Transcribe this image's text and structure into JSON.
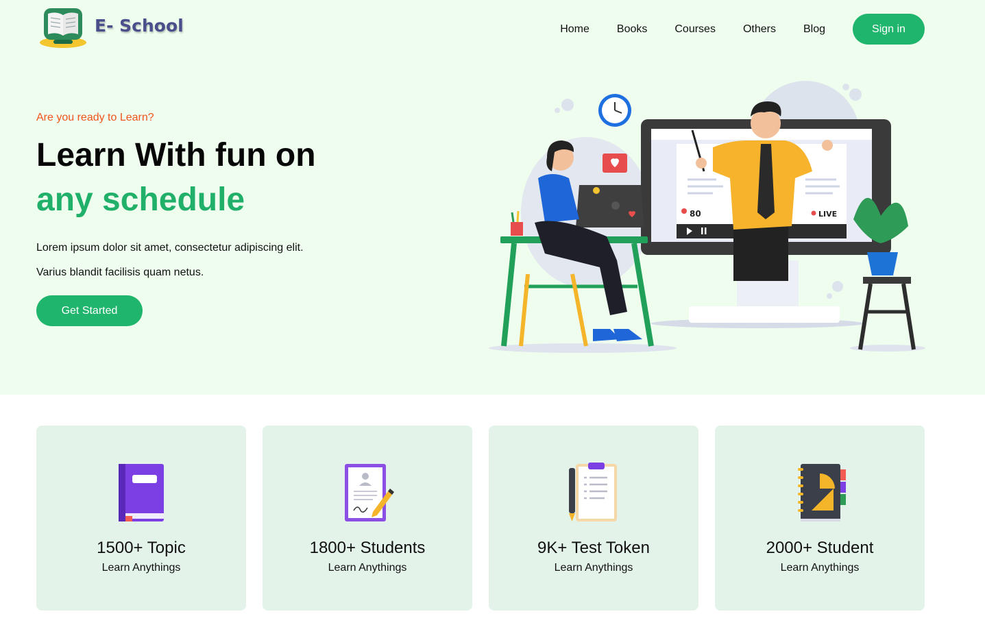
{
  "brand": {
    "name": "E- School",
    "logo_icon": "open-book-icon"
  },
  "nav": {
    "items": [
      "Home",
      "Books",
      "Courses",
      "Others",
      "Blog"
    ],
    "signin_label": "Sign in"
  },
  "hero": {
    "kicker": "Are you ready to Learn?",
    "title_line1": "Learn With fun on",
    "title_line2": "any schedule",
    "text_line1": "Lorem ipsum dolor sit amet, consectetur adipiscing elit.",
    "text_line2": "Varius blandit facilisis quam netus.",
    "cta_label": "Get Started",
    "illustration": {
      "viewer_count": "80",
      "live_label": "LIVE"
    }
  },
  "stats": [
    {
      "value": "1500+ Topic",
      "label": "Learn Anythings",
      "icon": "purple-book-icon"
    },
    {
      "value": "1800+ Students",
      "label": "Learn Anythings",
      "icon": "certificate-pen-icon"
    },
    {
      "value": "9K+ Test Token",
      "label": "Learn Anythings",
      "icon": "clipboard-pen-icon"
    },
    {
      "value": "2000+ Student",
      "label": "Learn Anythings",
      "icon": "geometry-notebook-icon"
    }
  ],
  "colors": {
    "accent": "#20b56d",
    "hero_bg": "#effdef",
    "kicker": "#f0541b",
    "card_bg": "#e4f3ea",
    "brand_text": "#4a4f8c"
  }
}
